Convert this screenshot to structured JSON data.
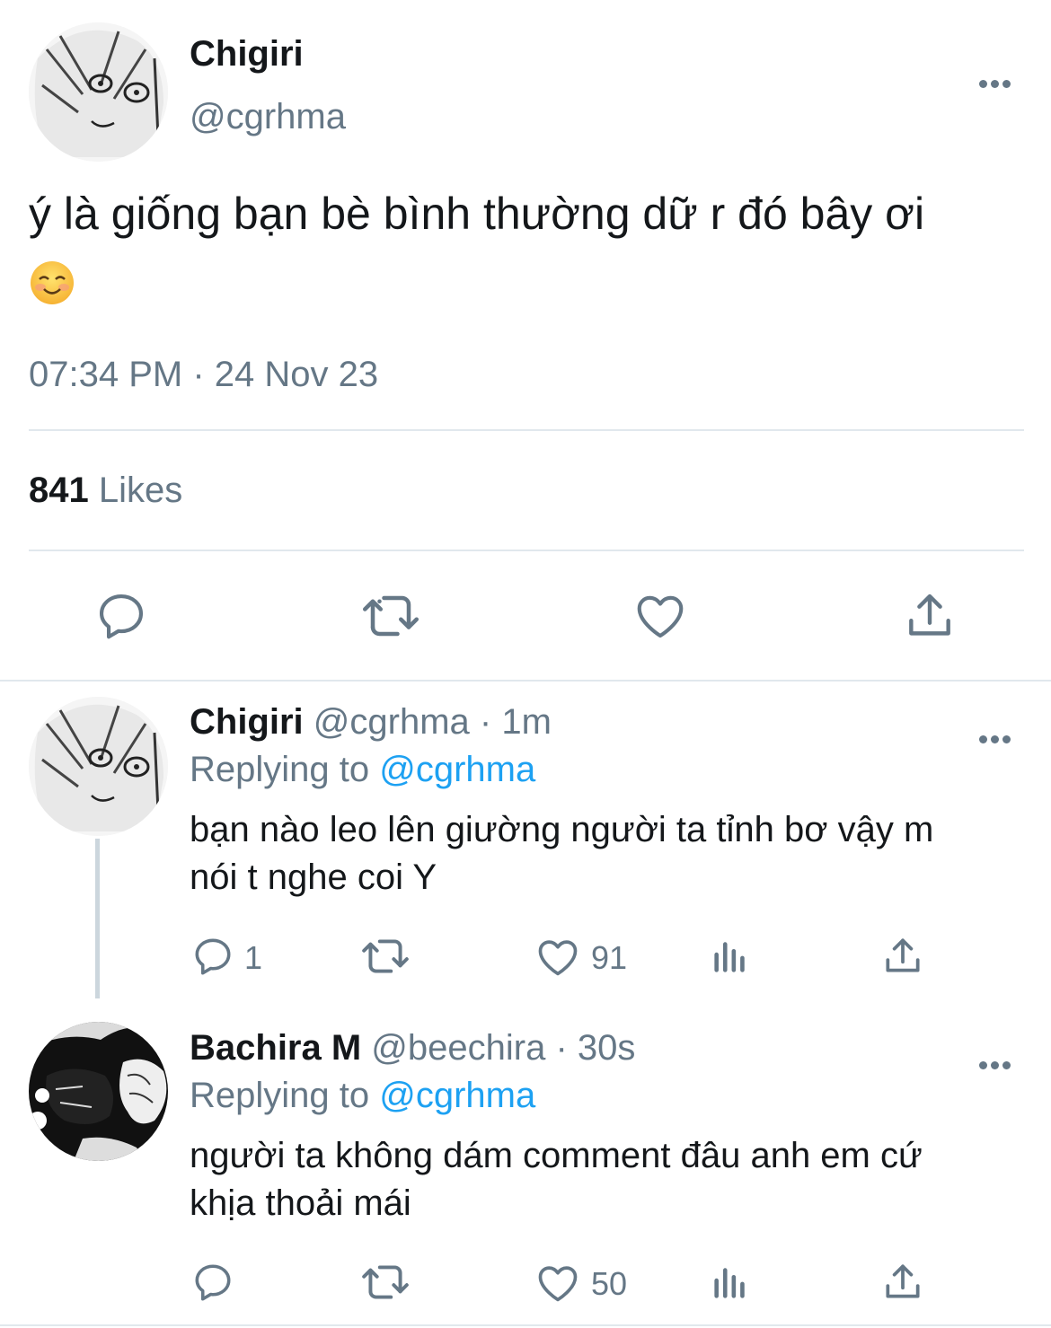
{
  "main_tweet": {
    "author_name": "Chigiri",
    "author_handle": "@cgrhma",
    "text": "ý là giống bạn bè bình thường dữ r đó bây ơi",
    "emoji": "smiling-face-emoji",
    "time": "07:34 PM",
    "separator": "·",
    "date": "24 Nov 23",
    "likes_count": "841",
    "likes_label": "Likes"
  },
  "replies": [
    {
      "author_name": "Chigiri",
      "author_handle": "@cgrhma",
      "age": "1m",
      "replying_prefix": "Replying to",
      "replying_to": "@cgrhma",
      "text_line1": "bạn nào leo lên giường người ta tỉnh bơ vậy m",
      "text_line2": "nói t nghe coi Y",
      "reply_count": "1",
      "retweet_count": "",
      "like_count": "91"
    },
    {
      "author_name": "Bachira M",
      "author_handle": "@beechira",
      "age": "30s",
      "replying_prefix": "Replying to",
      "replying_to": "@cgrhma",
      "text_line1": "người ta không dám comment đâu anh em cứ",
      "text_line2": "khịa thoải mái",
      "reply_count": "",
      "retweet_count": "",
      "like_count": "50"
    }
  ],
  "icons": [
    "reply-icon",
    "retweet-icon",
    "like-icon",
    "share-icon",
    "analytics-icon",
    "more-icon"
  ],
  "colors": {
    "text": "#14171a",
    "secondary": "#657786",
    "mention": "#1da1f2",
    "divider": "#e1e8ed"
  }
}
